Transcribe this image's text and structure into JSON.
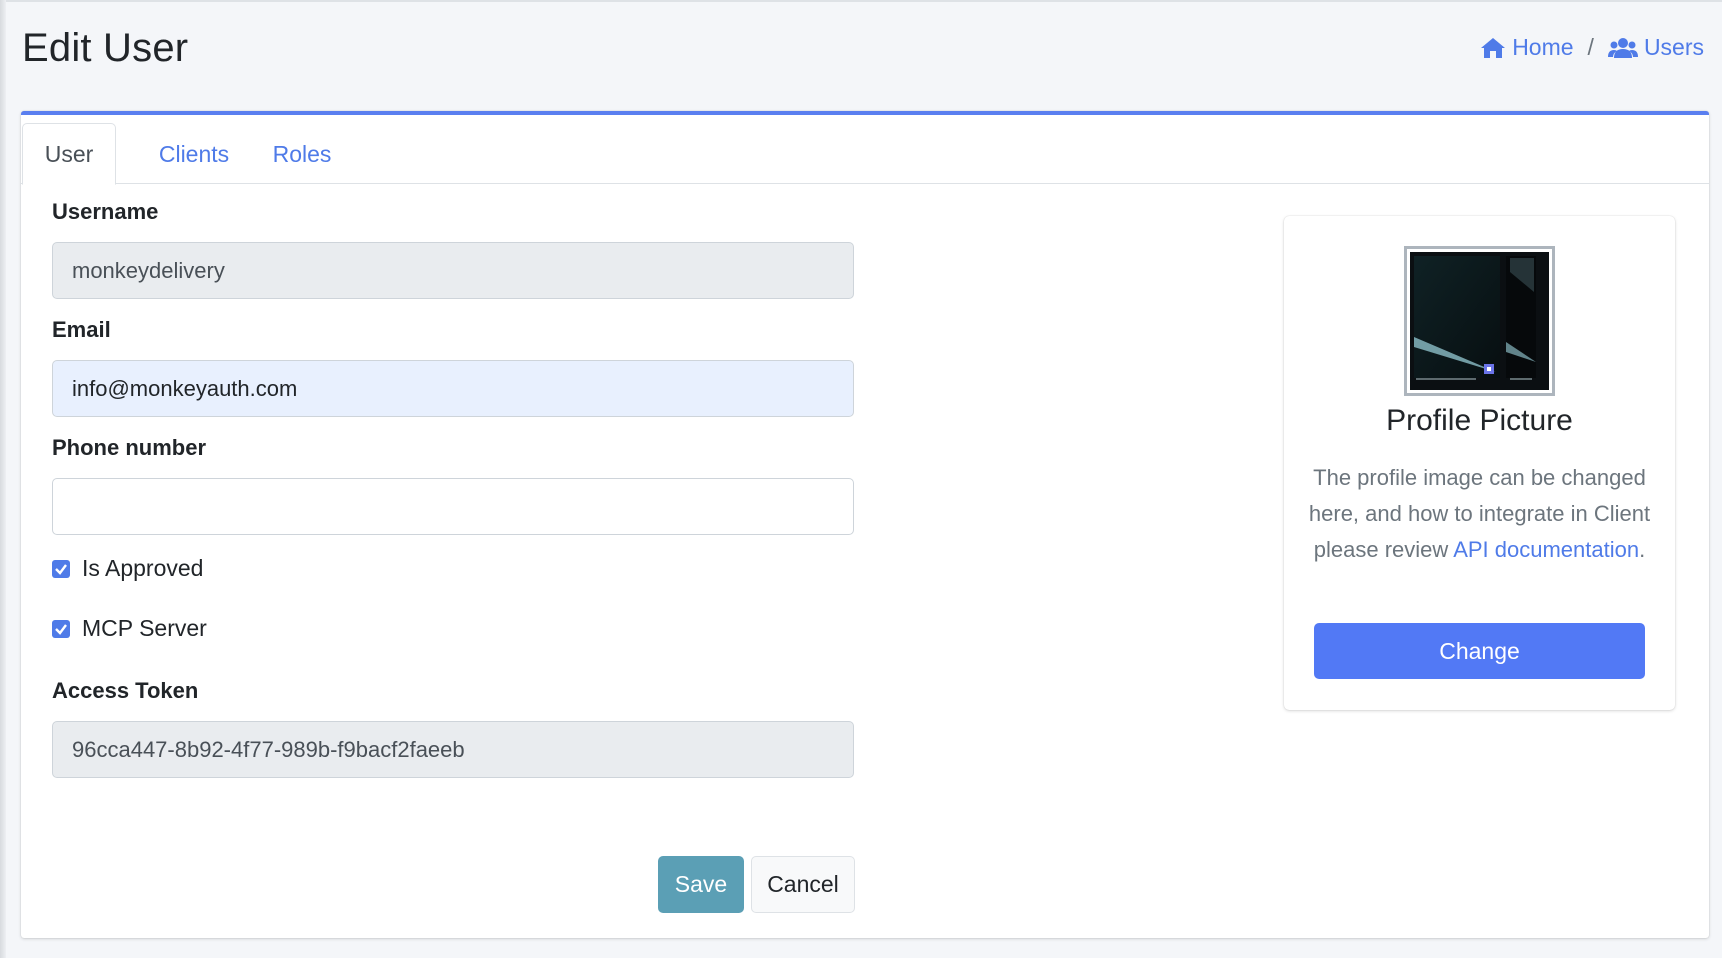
{
  "header": {
    "title": "Edit User",
    "breadcrumb": [
      {
        "label": "Home",
        "icon": "home-icon"
      },
      {
        "label": "Users",
        "icon": "users-icon"
      }
    ],
    "separator": "/"
  },
  "tabs": [
    {
      "label": "User",
      "active": true
    },
    {
      "label": "Clients",
      "active": false
    },
    {
      "label": "Roles",
      "active": false
    }
  ],
  "form": {
    "username": {
      "label": "Username",
      "value": "monkeydelivery"
    },
    "email": {
      "label": "Email",
      "value": "info@monkeyauth.com"
    },
    "phone": {
      "label": "Phone number",
      "value": ""
    },
    "is_approved": {
      "label": "Is Approved",
      "checked": true
    },
    "mcp_server": {
      "label": "MCP Server",
      "checked": true
    },
    "access_token": {
      "label": "Access Token",
      "value": "96cca447-8b92-4f77-989b-f9bacf2faeeb"
    },
    "save_label": "Save",
    "cancel_label": "Cancel"
  },
  "profile": {
    "title": "Profile Picture",
    "description": "The profile image can be changed here, and how to integrate in Client please review",
    "link_text": "API documentation",
    "after_link": ".",
    "change_label": "Change"
  },
  "colors": {
    "accent": "#4f7be8",
    "card_top_border": "#5a7ff0",
    "save_button": "#5b9fb5",
    "change_button": "#5279f5"
  }
}
